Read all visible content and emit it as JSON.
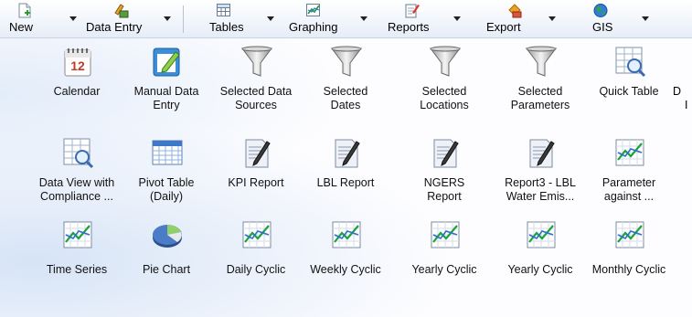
{
  "toolbar": {
    "items": [
      {
        "label": "New",
        "icon": "new-document-icon"
      },
      {
        "label": "Data Entry",
        "icon": "data-entry-icon"
      },
      {
        "label": "Tables",
        "icon": "table-icon"
      },
      {
        "label": "Graphing",
        "icon": "graph-icon"
      },
      {
        "label": "Reports",
        "icon": "report-icon"
      },
      {
        "label": "Export",
        "icon": "export-icon"
      },
      {
        "label": "GIS",
        "icon": "globe-icon"
      }
    ]
  },
  "tiles": {
    "calendar": {
      "line1": "Calendar",
      "line2": "",
      "icon": "calendar-icon"
    },
    "manual_entry": {
      "line1": "Manual Data",
      "line2": "Entry",
      "icon": "edit-pencil-icon"
    },
    "sel_sources": {
      "line1": "Selected Data",
      "line2": "Sources",
      "icon": "funnel-icon"
    },
    "sel_dates": {
      "line1": "Selected",
      "line2": "Dates",
      "icon": "funnel-icon"
    },
    "sel_locations": {
      "line1": "Selected",
      "line2": "Locations",
      "icon": "funnel-icon"
    },
    "sel_params": {
      "line1": "Selected",
      "line2": "Parameters",
      "icon": "funnel-icon"
    },
    "quick_table": {
      "line1": "Quick Table",
      "line2": "",
      "icon": "table-magnifier-icon"
    },
    "clipped": {
      "line1": "D",
      "line2": "I"
    },
    "data_view": {
      "line1": "Data View with",
      "line2": "Compliance ...",
      "icon": "table-magnifier-icon"
    },
    "pivot_table": {
      "line1": "Pivot Table",
      "line2": "(Daily)",
      "icon": "pivot-table-icon"
    },
    "kpi_report": {
      "line1": "KPI Report",
      "line2": "",
      "icon": "report-icon"
    },
    "lbl_report": {
      "line1": "LBL Report",
      "line2": "",
      "icon": "report-icon"
    },
    "ngers_report": {
      "line1": "NGERS",
      "line2": "Report",
      "icon": "report-icon"
    },
    "report3": {
      "line1": "Report3 - LBL",
      "line2": "Water Emis...",
      "icon": "report-icon"
    },
    "param_against": {
      "line1": "Parameter",
      "line2": "against ...",
      "icon": "line-graph-icon"
    },
    "time_series": {
      "line1": "Time Series",
      "line2": "",
      "icon": "line-graph-icon"
    },
    "pie_chart": {
      "line1": "Pie Chart",
      "line2": "",
      "icon": "pie-chart-icon"
    },
    "daily_cyclic": {
      "line1": "Daily Cyclic",
      "line2": "",
      "icon": "line-graph-icon"
    },
    "weekly_cyclic": {
      "line1": "Weekly Cyclic",
      "line2": "",
      "icon": "line-graph-icon"
    },
    "yearly_cyclic_1": {
      "line1": "Yearly Cyclic",
      "line2": "",
      "icon": "line-graph-icon"
    },
    "yearly_cyclic_2": {
      "line1": "Yearly Cyclic",
      "line2": "",
      "icon": "line-graph-icon"
    },
    "monthly_cyclic": {
      "line1": "Monthly Cyclic",
      "line2": "",
      "icon": "line-graph-icon"
    }
  }
}
